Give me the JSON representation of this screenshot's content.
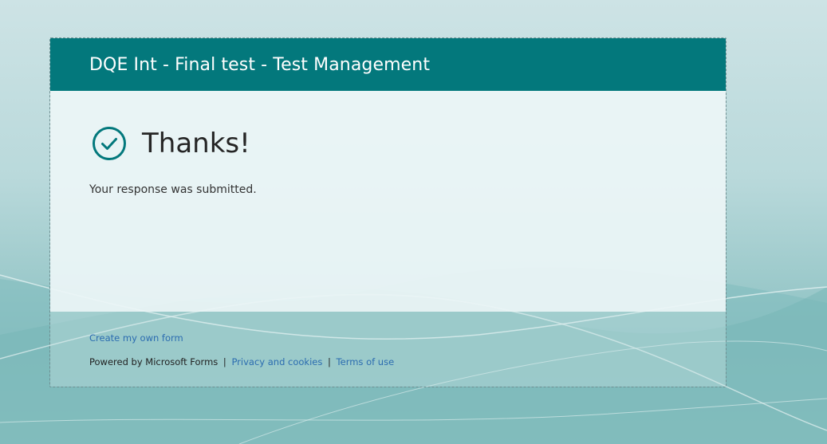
{
  "header": {
    "form_title": "DQE Int - Final test - Test Management"
  },
  "confirmation": {
    "heading": "Thanks!",
    "message": "Your response was submitted.",
    "icon": "check-circle-icon"
  },
  "footer": {
    "create_form_link": "Create my own form",
    "powered_by": "Powered by Microsoft Forms",
    "separator": "|",
    "privacy_link": "Privacy and cookies",
    "terms_link": "Terms of use"
  },
  "colors": {
    "header_bg": "#03787c",
    "accent": "#03787c",
    "link": "#2b6cb0"
  }
}
